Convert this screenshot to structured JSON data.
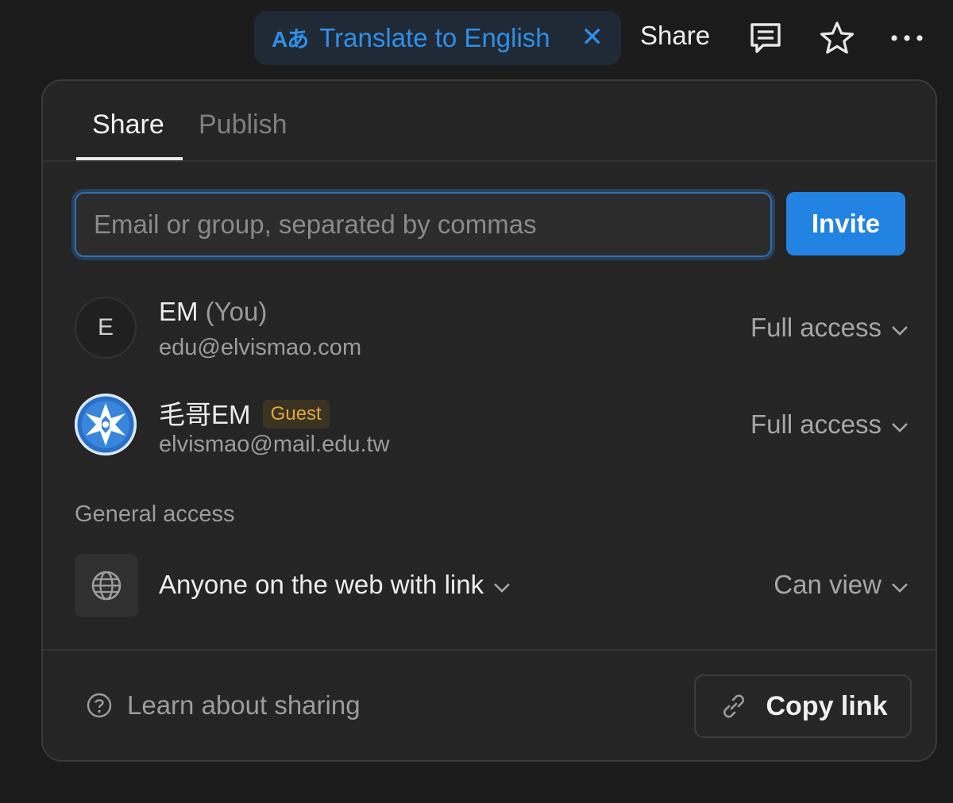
{
  "topbar": {
    "translate_glyph": "Aあ",
    "translate_label": "Translate to English",
    "close_glyph": "✕",
    "share_label": "Share"
  },
  "tabs": [
    {
      "label": "Share",
      "active": true
    },
    {
      "label": "Publish",
      "active": false
    }
  ],
  "invite": {
    "input_placeholder": "Email or group, separated by commas",
    "input_value": "",
    "button_label": "Invite"
  },
  "members": [
    {
      "avatar_letter": "E",
      "name": "EM",
      "you_suffix": "(You)",
      "email": "edu@elvismao.com",
      "access": "Full access"
    },
    {
      "name": "毛哥EM",
      "badge": "Guest",
      "email": "elvismao@mail.edu.tw",
      "access": "Full access"
    }
  ],
  "general": {
    "section_label": "General access",
    "link_scope": "Anyone on the web with link",
    "permission": "Can view"
  },
  "footer": {
    "learn_label": "Learn about sharing",
    "copy_label": "Copy link"
  },
  "colors": {
    "accent": "#2383e2",
    "guest_badge_text": "#e0a83a",
    "panel_bg": "#252525"
  }
}
